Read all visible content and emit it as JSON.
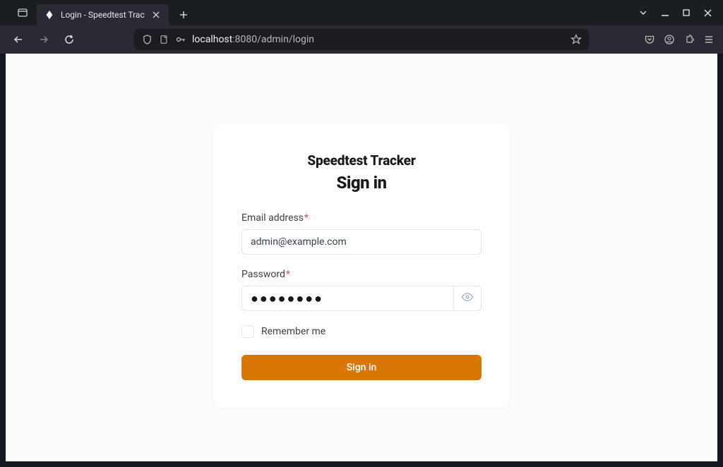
{
  "browser": {
    "tab_title": "Login - Speedtest Trac",
    "url_host": "localhost",
    "url_rest": ":8080/admin/login"
  },
  "login": {
    "app_title": "Speedtest Tracker",
    "heading": "Sign in",
    "email_label": "Email address",
    "email_value": "admin@example.com",
    "password_label": "Password",
    "password_mask": "●●●●●●●●",
    "remember_label": "Remember me",
    "submit_label": "Sign in",
    "accent_color": "#d97706"
  }
}
